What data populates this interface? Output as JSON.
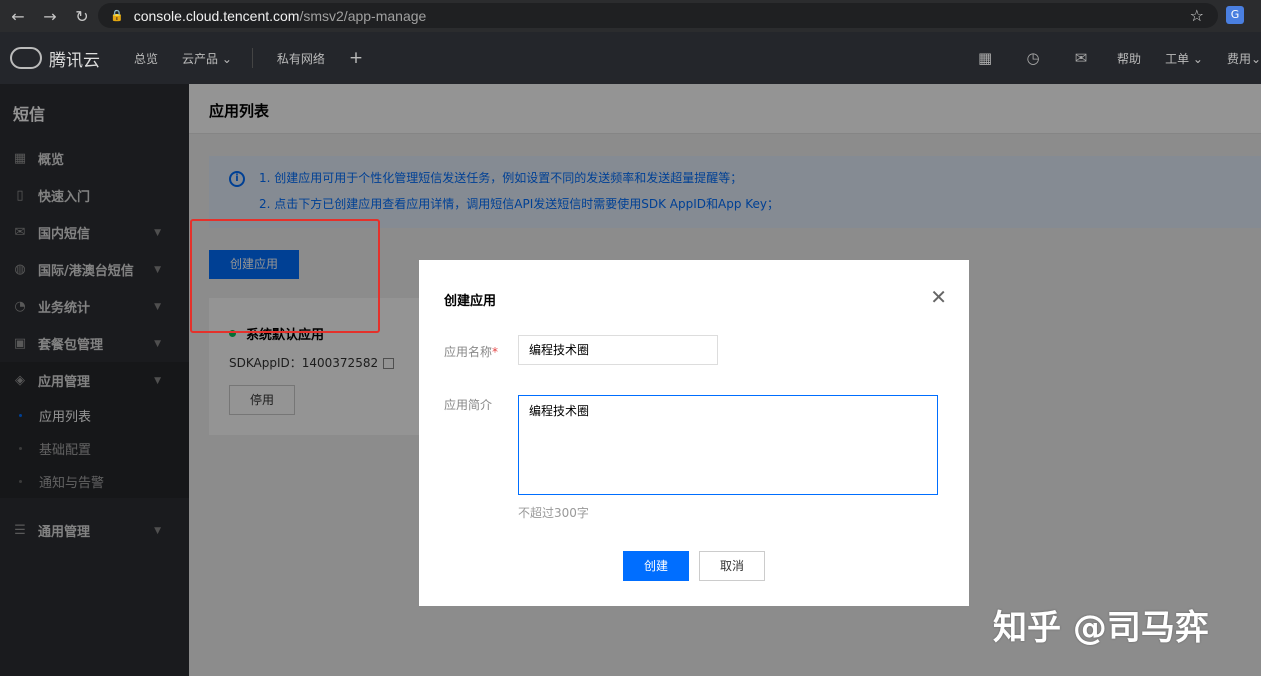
{
  "browser": {
    "url_host": "console.cloud.tencent.com",
    "url_path": "/smsv2/app-manage",
    "ext_label": "G"
  },
  "topnav": {
    "brand": "腾讯云",
    "items": [
      "总览",
      "云产品 ⌄",
      "私有网络"
    ],
    "plus": "+",
    "right_items": [
      "帮助",
      "工单 ⌄",
      "费用⌄"
    ]
  },
  "sidebar": {
    "title": "短信",
    "items": [
      {
        "label": "概览",
        "icon": "grid-icon"
      },
      {
        "label": "快速入门",
        "icon": "book-icon"
      },
      {
        "label": "国内短信",
        "icon": "mail-icon"
      },
      {
        "label": "国际/港澳台短信",
        "icon": "globe-icon"
      },
      {
        "label": "业务统计",
        "icon": "pie-icon"
      },
      {
        "label": "套餐包管理",
        "icon": "package-icon"
      },
      {
        "label": "应用管理",
        "icon": "layers-icon"
      },
      {
        "label": "通用管理",
        "icon": "sliders-icon"
      }
    ],
    "subitems": [
      "应用列表",
      "基础配置",
      "通知与告警"
    ]
  },
  "main": {
    "page_title": "应用列表",
    "info_lines": [
      "1. 创建应用可用于个性化管理短信发送任务，例如设置不同的发送频率和发送超量提醒等；",
      "2. 点击下方已创建应用查看应用详情，调用短信API发送短信时需要使用SDK AppID和App Key；"
    ],
    "create_button": "创建应用",
    "card": {
      "title": "系统默认应用",
      "sdk_label": "SDKAppID：",
      "sdk_value": "1400372582",
      "disable_button": "停用"
    }
  },
  "dialog": {
    "title": "创建应用",
    "name_label": "应用名称",
    "name_required": "*",
    "name_value": "编程技术圈",
    "desc_label": "应用简介",
    "desc_value": "编程技术圈",
    "hint": "不超过300字",
    "ok_button": "创建",
    "cancel_button": "取消"
  },
  "watermark": "知乎 @司马弈",
  "colors": {
    "accent": "#006eff",
    "sidebar_bg": "#2d2f34",
    "topnav_bg": "#24262b",
    "highlight_box": "#e5312b",
    "status_green": "#0abf5b"
  }
}
